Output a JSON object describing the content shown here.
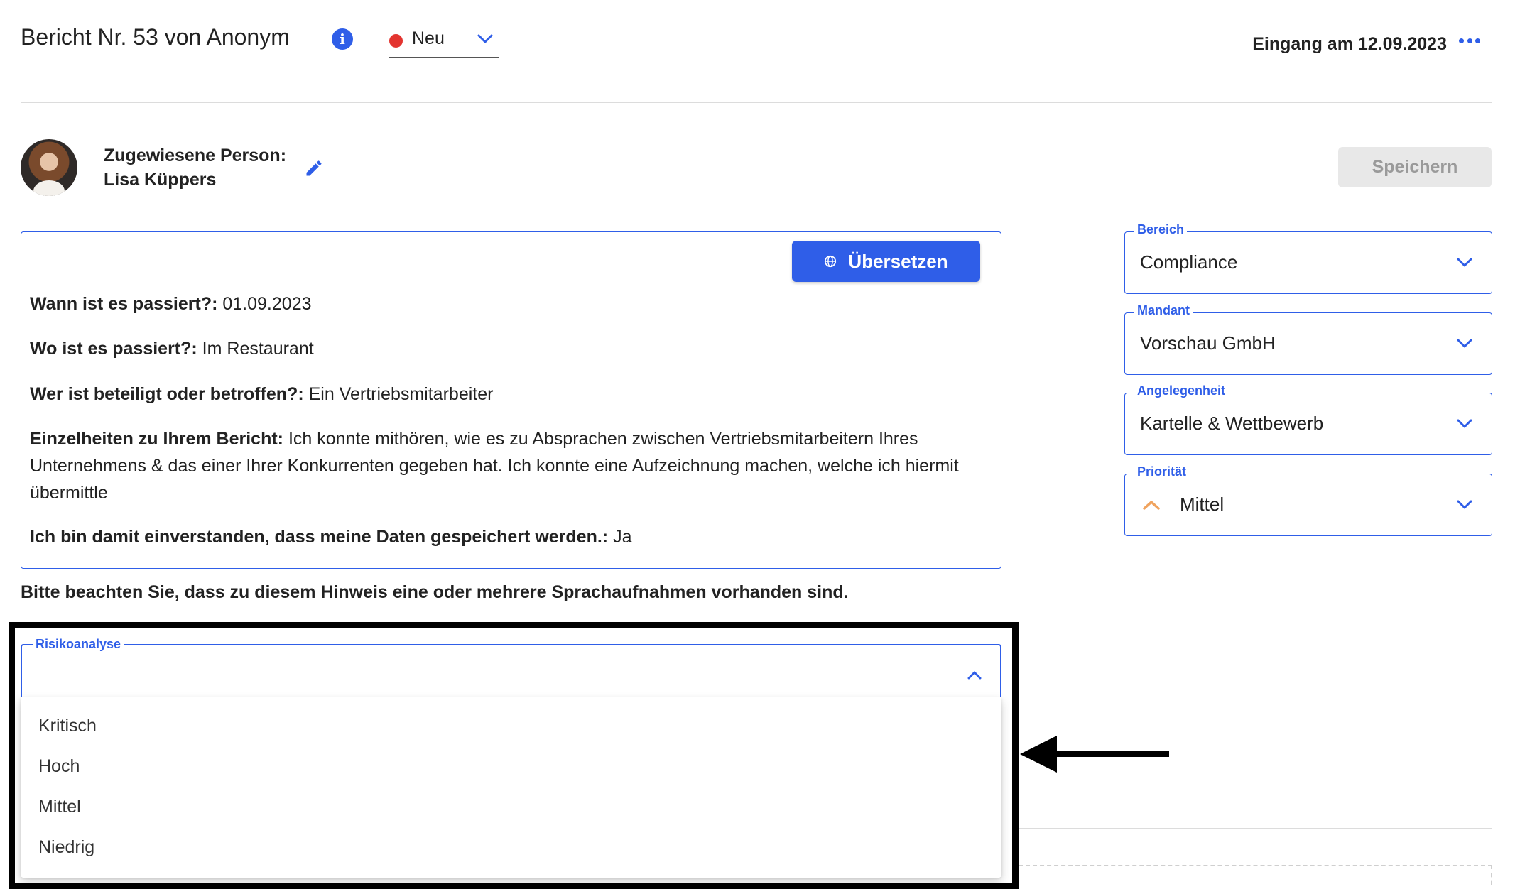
{
  "header": {
    "title": "Bericht Nr. 53 von Anonym",
    "status": "Neu",
    "received": "Eingang am 12.09.2023"
  },
  "assignee": {
    "label": "Zugewiesene Person:",
    "name": "Lisa Küppers"
  },
  "actions": {
    "save_label": "Speichern",
    "translate_label": "Übersetzen"
  },
  "report": {
    "items": [
      {
        "question": "Wann ist es passiert?:",
        "answer": "01.09.2023"
      },
      {
        "question": "Wo ist es passiert?:",
        "answer": "Im Restaurant"
      },
      {
        "question": "Wer ist beteiligt oder betroffen?:",
        "answer": "Ein Vertriebsmitarbeiter"
      },
      {
        "question": "Einzelheiten zu Ihrem Bericht:",
        "answer": "Ich konnte mithören, wie es zu Absprachen zwischen Vertriebsmitarbeitern Ihres Unternehmens & das einer Ihrer Konkurrenten gegeben hat. Ich konnte eine Aufzeichnung machen, welche ich hiermit übermittle"
      },
      {
        "question": "Ich bin damit einverstanden, dass meine Daten gespeichert werden.:",
        "answer": "Ja"
      }
    ],
    "notice": "Bitte beachten Sie, dass zu diesem Hinweis eine oder mehrere Sprachaufnahmen vorhanden sind."
  },
  "fields": {
    "bereich": {
      "label": "Bereich",
      "value": "Compliance"
    },
    "mandant": {
      "label": "Mandant",
      "value": "Vorschau GmbH"
    },
    "angelegenheit": {
      "label": "Angelegenheit",
      "value": "Kartelle & Wettbewerb"
    },
    "prioritaet": {
      "label": "Priorität",
      "value": "Mittel",
      "icon": "chevron-up-icon",
      "icon_color": "#f0a35e"
    }
  },
  "risk": {
    "label": "Risikoanalyse",
    "options": [
      "Kritisch",
      "Hoch",
      "Mittel",
      "Niedrig"
    ]
  },
  "colors": {
    "accent": "#2f5ee8",
    "status_dot": "#e3342f",
    "annotation": "#000000"
  }
}
